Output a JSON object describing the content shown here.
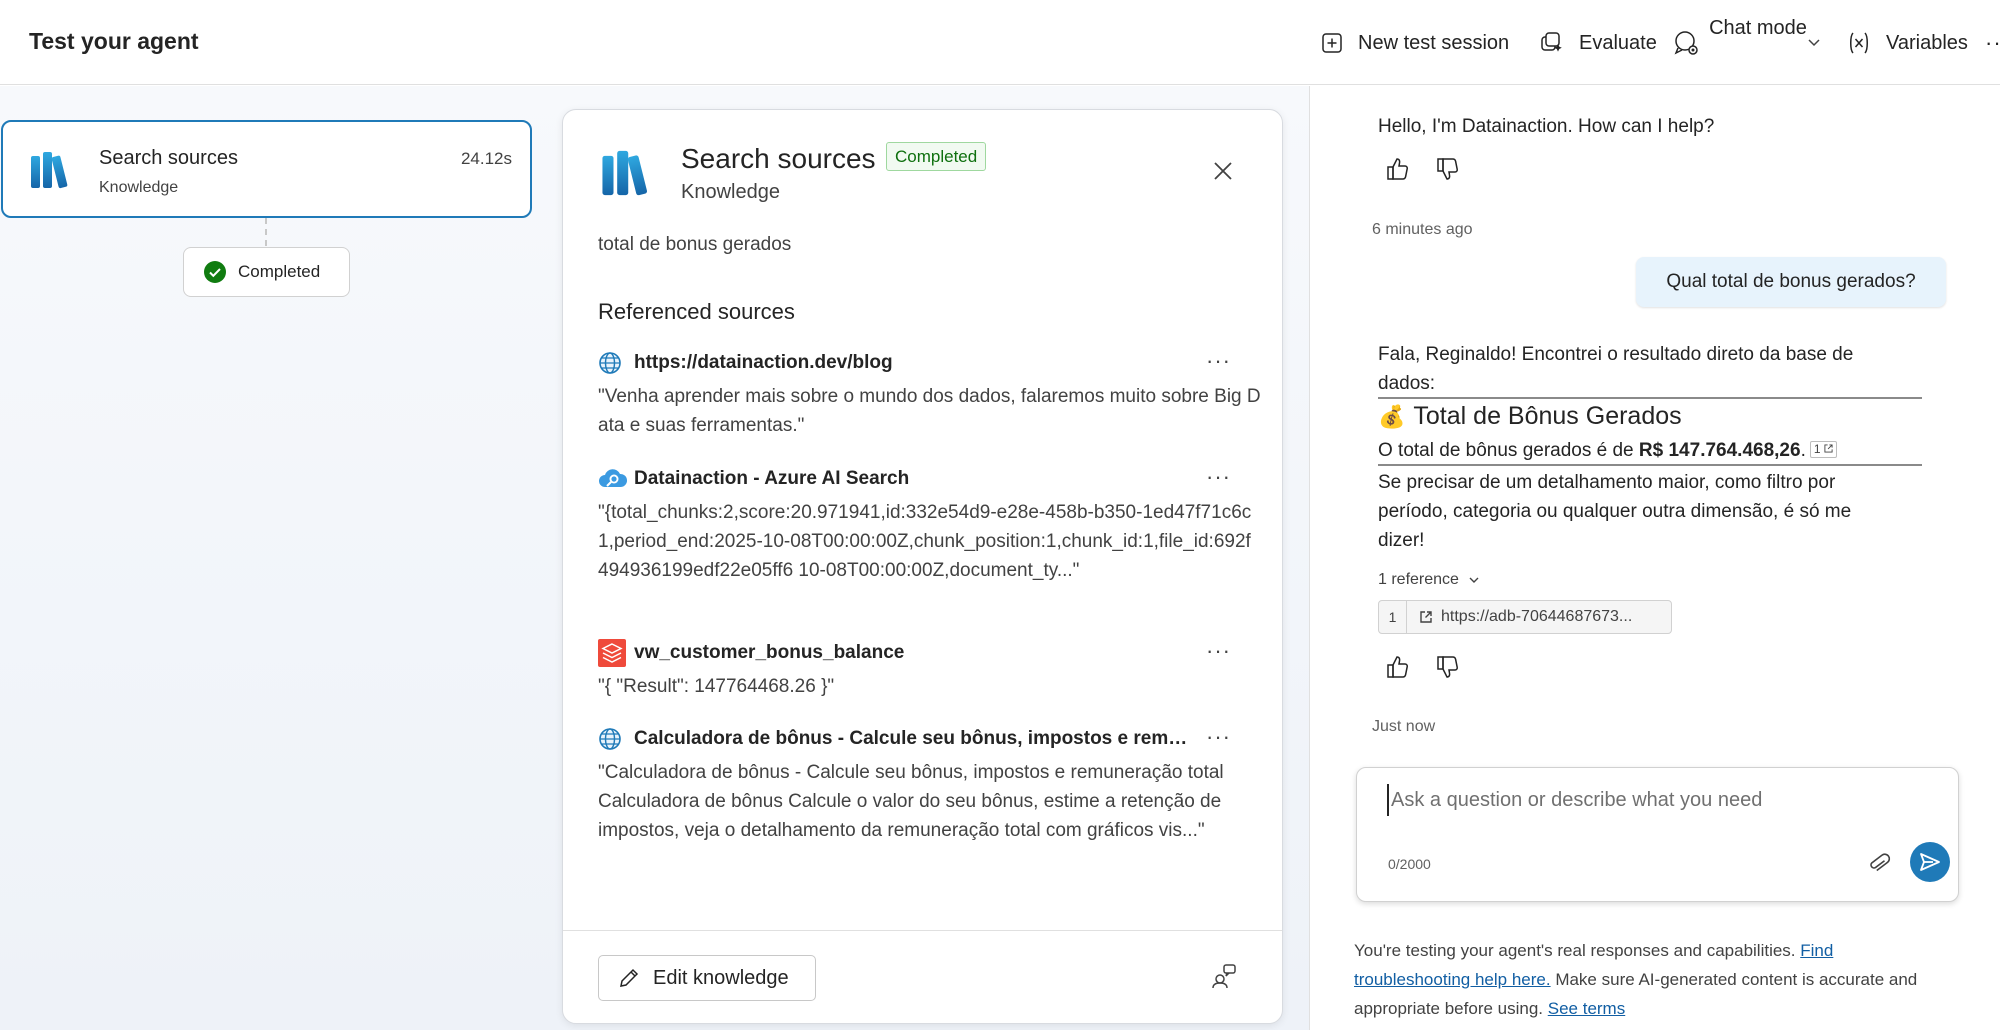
{
  "header": {
    "title": "Test your agent",
    "new_session": "New test session",
    "evaluate": "Evaluate",
    "chat_mode": "Chat mode",
    "variables": "Variables",
    "more": "···"
  },
  "step": {
    "title": "Search sources",
    "subtitle": "Knowledge",
    "duration": "24.12s",
    "status": "Completed"
  },
  "detail": {
    "title": "Search sources",
    "badge": "Completed",
    "subtitle": "Knowledge",
    "query": "total de bonus gerados",
    "referenced_heading": "Referenced sources",
    "sources": [
      {
        "icon": "globe-icon",
        "title": "https://datainaction.dev/blog",
        "text": "\"Venha aprender mais sobre o mundo dos dados, falaremos muito sobre Big Data e suas ferramentas.\""
      },
      {
        "icon": "azure-search-icon",
        "title": "Datainaction - Azure AI Search",
        "text": "\"{total_chunks:2,score:20.971941,id:332e54d9-e28e-458b-b350-1ed47f71c6c1,period_end:2025-10-08T00:00:00Z,chunk_position:1,chunk_id:1,file_id:692f494936199edf22e05ff6 10-08T00:00:00Z,document_ty...\""
      },
      {
        "icon": "database-icon",
        "title": "vw_customer_bonus_balance",
        "text": "\"{ \"Result\": 147764468.26 }\""
      },
      {
        "icon": "globe-icon",
        "title": "Calculadora de bônus - Calcule seu bônus, impostos e remuneração total",
        "text": "\"Calculadora de bônus - Calcule seu bônus, impostos e remuneração total Calculadora de bônus Calcule o valor do seu bônus, estime a retenção de impostos, veja o detalhamento da remuneração total com gráficos vis...\""
      }
    ],
    "more": "···",
    "edit_knowledge": "Edit knowledge"
  },
  "chat": {
    "greeting": "Hello, I'm Datainaction. How can I help?",
    "greeting_time": "6 minutes ago",
    "user_message": "Qual total de bonus gerados?",
    "response_intro": "Fala, Reginaldo! Encontrei o resultado direto da base de dados:",
    "response_heading_emoji": "💰",
    "response_heading": "Total de Bônus Gerados",
    "response_line_prefix": "O total de bônus gerados é de ",
    "response_amount": "R$ 147.764.468,26",
    "response_line_suffix": ".",
    "citation": "1",
    "response_followup": "Se precisar de um detalhamento maior, como filtro por período, categoria ou qualquer outra dimensão, é só me dizer!",
    "reference_toggle": "1 reference",
    "reference_num": "1",
    "reference_url": "https://adb-70644687673...",
    "response_time": "Just now",
    "input_placeholder": "Ask a question or describe what you need",
    "counter": "0/2000",
    "disclaimer_prefix": "You're testing your agent's real responses and capabilities. ",
    "disclaimer_link1": "Find troubleshooting help here.",
    "disclaimer_middle": " Make sure AI-generated content is accurate and appropriate before using. ",
    "disclaimer_link2": "See terms"
  },
  "colors": {
    "accent": "#1f7ab8",
    "success": "#107c10",
    "bubble": "#e7f3fc"
  }
}
